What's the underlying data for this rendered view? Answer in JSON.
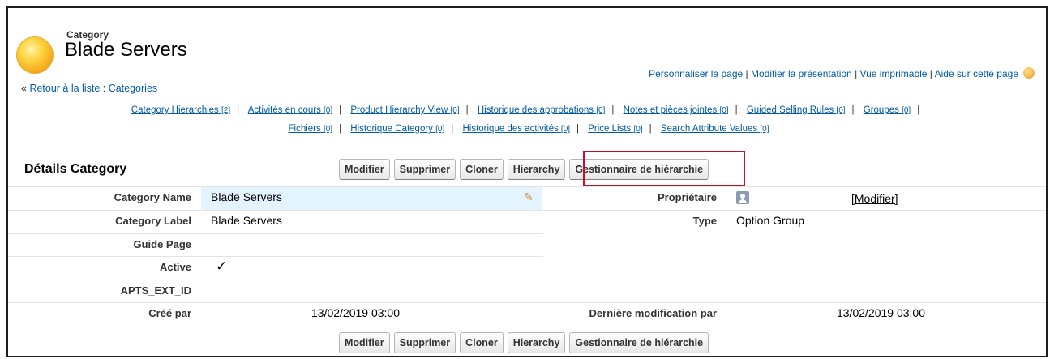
{
  "header": {
    "type_label": "Category",
    "title": "Blade Servers"
  },
  "top_links": {
    "customize": "Personnaliser la page",
    "edit_layout": "Modifier la présentation",
    "printable": "Vue imprimable",
    "help": "Aide sur cette page",
    "separator": "|"
  },
  "back_link": {
    "prefix": "« ",
    "label": "Retour à la liste : Categories"
  },
  "related_lists": [
    {
      "label": "Category Hierarchies",
      "count": "[2]"
    },
    {
      "label": "Activités en cours",
      "count": "[0]"
    },
    {
      "label": "Product Hierarchy View",
      "count": "[0]"
    },
    {
      "label": "Historique des approbations",
      "count": "[0]"
    },
    {
      "label": "Notes et pièces jointes",
      "count": "[0]"
    },
    {
      "label": "Guided Selling Rules",
      "count": "[0]"
    },
    {
      "label": "Groupes",
      "count": "[0]"
    },
    {
      "label": "Fichiers",
      "count": "[0]"
    },
    {
      "label": "Historique Category",
      "count": "[0]"
    },
    {
      "label": "Historique des activités",
      "count": "[0]"
    },
    {
      "label": "Price Lists",
      "count": "[0]"
    },
    {
      "label": "Search Attribute Values",
      "count": "[0]"
    }
  ],
  "section": {
    "title": "Détails Category"
  },
  "buttons": {
    "edit": "Modifier",
    "delete": "Supprimer",
    "clone": "Cloner",
    "hierarchy": "Hierarchy",
    "hierarchy_manager": "Gestionnaire de hiérarchie"
  },
  "fields": {
    "category_name": {
      "label": "Category Name",
      "value": "Blade Servers"
    },
    "owner": {
      "label": "Propriétaire",
      "action": "[Modifier]"
    },
    "category_label": {
      "label": "Category Label",
      "value": "Blade Servers"
    },
    "type": {
      "label": "Type",
      "value": "Option Group"
    },
    "guide_page": {
      "label": "Guide Page",
      "value": ""
    },
    "active": {
      "label": "Active",
      "value": "✓"
    },
    "apts_ext_id": {
      "label": "APTS_EXT_ID",
      "value": ""
    },
    "created_by": {
      "label": "Créé par",
      "value": "13/02/2019 03:00"
    },
    "last_modified_by": {
      "label": "Dernière modification par",
      "value": "13/02/2019 03:00"
    }
  },
  "colors": {
    "link": "#015ba7",
    "highlight_border": "#c8102e",
    "field_highlight": "#e3f3ff"
  }
}
